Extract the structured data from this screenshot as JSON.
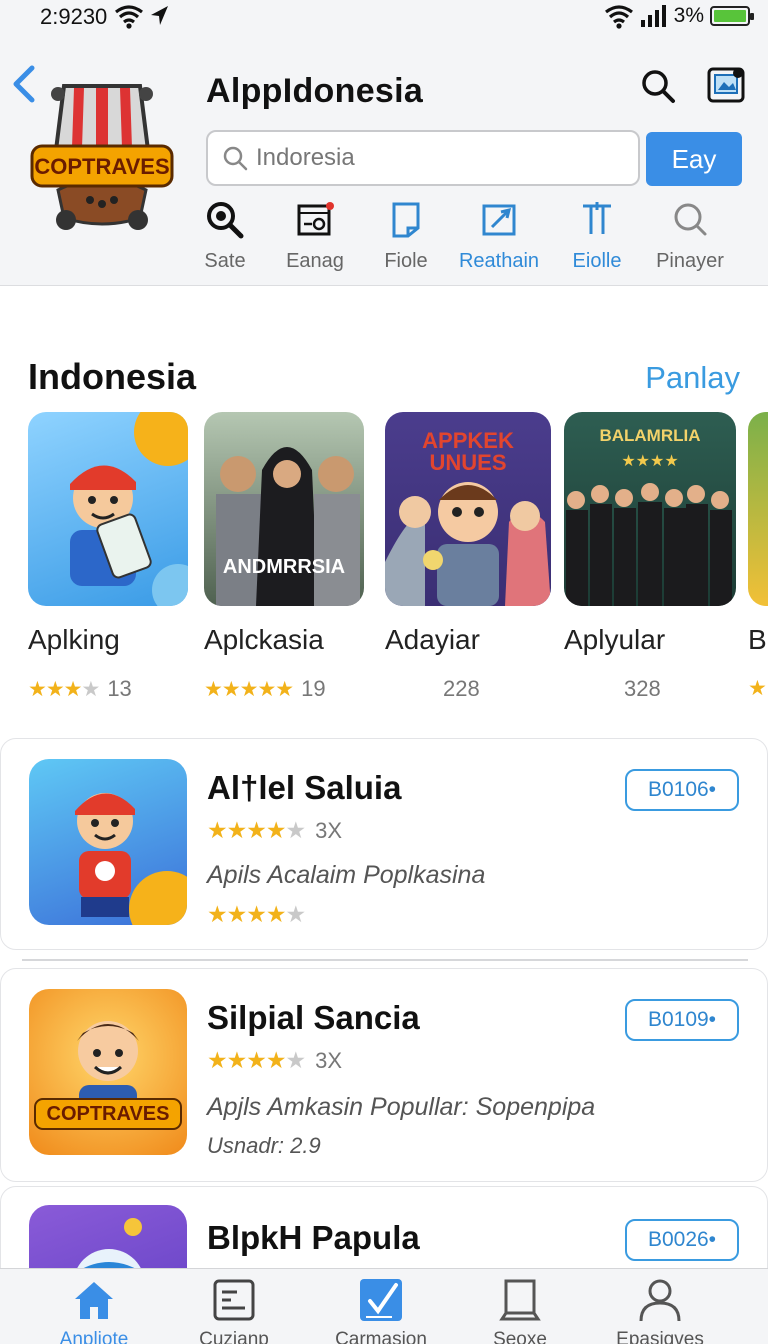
{
  "status_bar": {
    "time": "2:9230",
    "battery_pct": "3%"
  },
  "header": {
    "title": "AlppIdonesia",
    "search": {
      "placeholder": "Indoresia"
    },
    "search_button": "Eay",
    "categories": [
      {
        "label": "Sate",
        "icon": "magnifier-zoom-icon"
      },
      {
        "label": "Eanag",
        "icon": "media-window-icon"
      },
      {
        "label": "Fiole",
        "icon": "file-icon"
      },
      {
        "label": "Reathain",
        "icon": "edit-window-icon",
        "active": true
      },
      {
        "label": "Eiolle",
        "icon": "tool-icon",
        "active": true
      },
      {
        "label": "Pinayer",
        "icon": "search-icon"
      }
    ],
    "logo_text": "COPTRAVES"
  },
  "section": {
    "title": "Indonesia",
    "link": "Panlay",
    "apps": [
      {
        "name": "Aplking",
        "rating": 3,
        "count": "13"
      },
      {
        "name": "Aplckasia",
        "rating": 5,
        "count": "19",
        "thumb_text": "ANDMRRSIA"
      },
      {
        "name": "Adayiar",
        "rating": 0,
        "count": "228",
        "thumb_text": "APPKEK UNUES"
      },
      {
        "name": "Aplyular",
        "rating": 0,
        "count": "328",
        "thumb_text": "BALAMRLIA"
      },
      {
        "name": "B",
        "rating": 1,
        "count": ""
      }
    ]
  },
  "list": [
    {
      "title": "Al†lel Saluia",
      "rating": 4.5,
      "count": "3X",
      "desc": "Apils Acalaim Poplkasina",
      "rating2": 4,
      "button": "B0106•"
    },
    {
      "title": "Silpial Sancia",
      "rating": 4.5,
      "count": "3X",
      "desc": "Apjls Amkasin Popullar: Sopenpipa",
      "extra": "Usnadr: 2.9",
      "button": "B0109•"
    },
    {
      "title": "BlpkH Papula",
      "button": "B0026•"
    }
  ],
  "tabbar": [
    {
      "label": "Anpliote",
      "icon": "home-icon",
      "active": true
    },
    {
      "label": "Cuzianp",
      "icon": "list-icon"
    },
    {
      "label": "Carmasion",
      "icon": "edit-check-icon"
    },
    {
      "label": "Seoxe",
      "icon": "book-icon"
    },
    {
      "label": "Epasiqves",
      "icon": "user-icon"
    }
  ],
  "colors": {
    "accent": "#3a8ee6",
    "star": "#f2b21a",
    "battery": "#58c43a"
  }
}
